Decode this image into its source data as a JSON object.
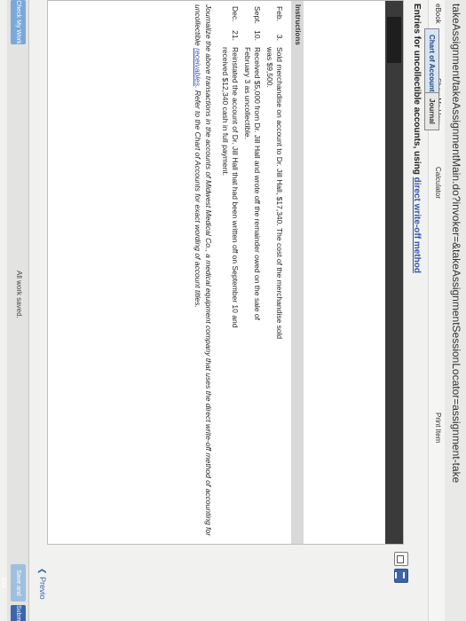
{
  "browser": {
    "url": "takeAssignment/takeAssignmentMain.do?invoker=&takeAssignmentSessionLocator=assignment-take"
  },
  "toolbar": {
    "ebook": "eBook",
    "show_me_how": "Show Me How",
    "calculator": "Calculator",
    "print_item": "Print Item"
  },
  "title": {
    "prefix": "Entries for uncollectible accounts, using ",
    "link": "direct write-off method"
  },
  "tabs": {
    "chart_of_accounts": "Chart of Accounts",
    "journal": "Journal"
  },
  "instructions": {
    "header": "Instructions",
    "rows": [
      {
        "month": "Feb.",
        "day": "3.",
        "lines": [
          "Sold merchandise on account to Dr. Jill Hall, $17,340. The cost of the merchandise sold",
          "was $9,500."
        ]
      },
      {
        "month": "Sept.",
        "day": "10.",
        "lines": [
          "Received $5,000 from Dr. Jill Hall and wrote off the remainder owed on the sale of",
          "February 3 as uncollectible."
        ]
      },
      {
        "month": "Dec.",
        "day": "21.",
        "lines": [
          "Reinstated the account of Dr. Jill Hall that had been written off on September 10 and",
          "received $12,340 cash in full payment."
        ]
      }
    ],
    "para_line1": "Journalize the above transactions in the accounts of Midwest Medical Co., a medical equipment company that uses the direct write-off method of accounting for",
    "para_line2_prefix": "uncollectible ",
    "para_link": "receivables",
    "para_line2_suffix": ". Refer to the Chart of Accounts for exact wording of account titles."
  },
  "footer": {
    "check_my_work": "Check My Work",
    "status": "All work saved.",
    "save_exit": "Save and Exit",
    "submit": "Submit Ass",
    "previous": "Previo"
  }
}
